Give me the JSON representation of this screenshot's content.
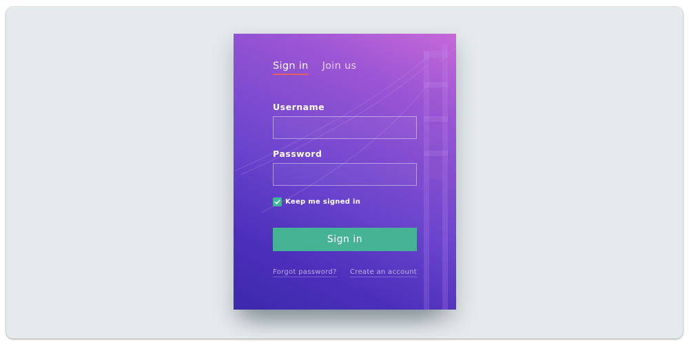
{
  "tabs": [
    {
      "label": "Sign in",
      "active": true
    },
    {
      "label": "Join us",
      "active": false
    }
  ],
  "form": {
    "username_label": "Username",
    "username_value": "",
    "password_label": "Password",
    "password_value": "",
    "keep_signed_in_label": "Keep me signed in",
    "keep_signed_in_checked": true,
    "submit_label": "Sign in"
  },
  "links": {
    "forgot": "Forgot password?",
    "create": "Create an account"
  },
  "colors": {
    "gradient_top": "#c768d9",
    "gradient_bottom": "#3c29ab",
    "accent_green": "#45b394",
    "tab_underline": "#e8615f",
    "page_background": "#e5ebec"
  },
  "icons": {
    "checkbox": "checkmark-icon",
    "background": "golden-gate-bridge-image"
  }
}
